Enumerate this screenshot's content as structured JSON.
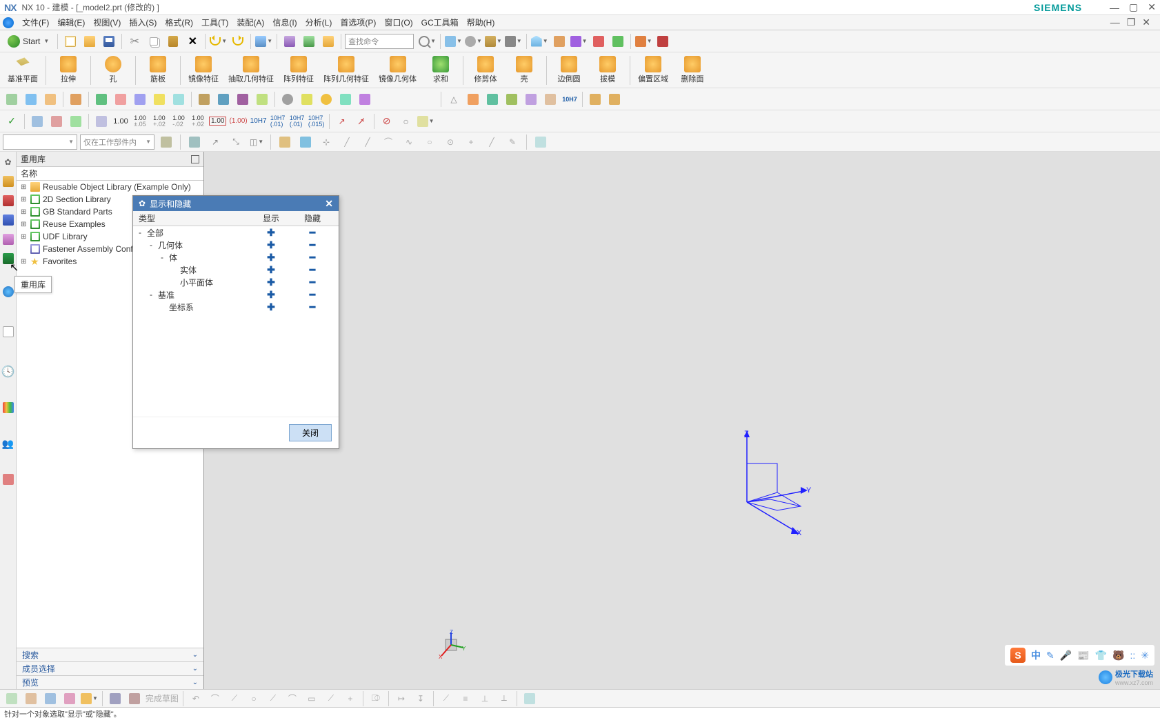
{
  "title": {
    "app": "NX",
    "version": "NX 10 - 建模 - [_model2.prt  (修改的) ]",
    "brand": "SIEMENS"
  },
  "menu": {
    "items": [
      "文件(F)",
      "编辑(E)",
      "视图(V)",
      "插入(S)",
      "格式(R)",
      "工具(T)",
      "装配(A)",
      "信息(I)",
      "分析(L)",
      "首选项(P)",
      "窗口(O)",
      "GC工具箱",
      "帮助(H)"
    ]
  },
  "toolbar1": {
    "start": "Start",
    "search_placeholder": "查找命令"
  },
  "ribbon": {
    "items": [
      "基准平面",
      "拉伸",
      "孔",
      "筋板",
      "镜像特征",
      "抽取几何特征",
      "阵列特征",
      "阵列几何特征",
      "镜像几何体",
      "求和",
      "修剪体",
      "壳",
      "边倒圆",
      "拔模",
      "偏置区域",
      "删除面"
    ]
  },
  "dim_row": {
    "vals": [
      "1.00",
      "1.00",
      "1.00",
      "1.00",
      "1.00",
      "1.00",
      "1.00",
      "10H7",
      "10H7",
      "10H7",
      "10H7"
    ],
    "subs": [
      "",
      "±.05",
      "+.02",
      "-.02",
      "+.02",
      "",
      "",
      "",
      "(.01)",
      "(.01)",
      "(.015)"
    ]
  },
  "filter": {
    "scope": "仅在工作部件内"
  },
  "side": {
    "title": "重用库",
    "col": "名称",
    "tree": [
      {
        "exp": "+",
        "icon": "folder",
        "label": "Reusable Object Library (Example Only)"
      },
      {
        "exp": "+",
        "icon": "lib",
        "label": "2D Section Library"
      },
      {
        "exp": "+",
        "icon": "lib",
        "label": "GB Standard Parts"
      },
      {
        "exp": "+",
        "icon": "lib",
        "label": "Reuse Examples"
      },
      {
        "exp": "+",
        "icon": "lib",
        "label": "UDF Library"
      },
      {
        "exp": "",
        "icon": "asm",
        "label": "Fastener Assembly Configuration"
      },
      {
        "exp": "+",
        "icon": "star",
        "label": "Favorites"
      }
    ],
    "sections": [
      "搜索",
      "成员选择",
      "预览"
    ]
  },
  "dialog": {
    "title": "显示和隐藏",
    "cols": [
      "类型",
      "显示",
      "隐藏"
    ],
    "rows": [
      {
        "indent": 0,
        "exp": "-",
        "label": "全部"
      },
      {
        "indent": 1,
        "exp": "-",
        "label": "几何体"
      },
      {
        "indent": 2,
        "exp": "-",
        "label": "体"
      },
      {
        "indent": 3,
        "exp": "",
        "label": "实体"
      },
      {
        "indent": 3,
        "exp": "",
        "label": "小平面体"
      },
      {
        "indent": 1,
        "exp": "-",
        "label": "基准"
      },
      {
        "indent": 2,
        "exp": "",
        "label": "坐标系"
      }
    ],
    "close": "关闭"
  },
  "tooltip": "重用库",
  "status": "针对一个对象选取\"显示\"或\"隐藏\"。",
  "tray": {
    "ime": "中",
    "items": [
      "✎",
      "🎤",
      "📰",
      "👕",
      "🐻",
      "::",
      "✳"
    ]
  },
  "watermark": {
    "name": "极光下载站",
    "url": "www.xz7.com"
  },
  "axes": {
    "x": "X",
    "y": "Y",
    "z": "Z"
  }
}
